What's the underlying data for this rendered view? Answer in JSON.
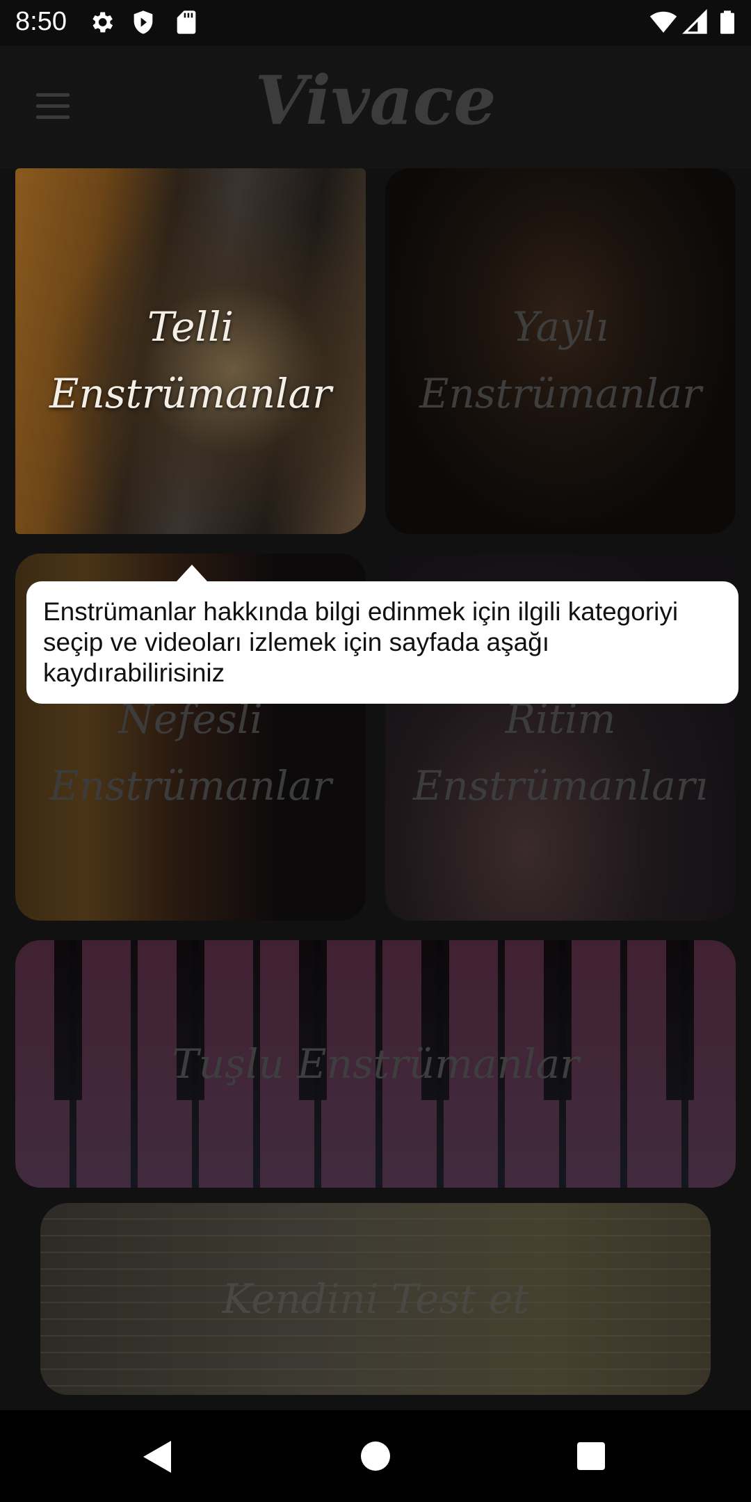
{
  "status_bar": {
    "time": "8:50",
    "left_icons": [
      "settings-icon",
      "shield-icon",
      "sd-card-icon"
    ],
    "right_icons": [
      "wifi-icon",
      "signal-icon",
      "battery-icon"
    ]
  },
  "app_bar": {
    "title": "Vivace",
    "menu_icon": "hamburger-menu-icon"
  },
  "categories": {
    "telli": {
      "line1": "Telli",
      "line2": "Enstrümanlar"
    },
    "yayli": {
      "line1": "Yaylı",
      "line2": "Enstrümanlar"
    },
    "nefesli": {
      "line1": "Nefesli",
      "line2": "Enstrümanlar"
    },
    "ritim": {
      "line1": "Ritim",
      "line2": "Enstrümanları"
    },
    "tuslu": {
      "label": "Tuşlu  Enstrümanlar"
    },
    "test": {
      "label": "Kendini Test et"
    }
  },
  "tooltip": {
    "text": "Enstrümanlar hakkında bilgi edinmek için ilgili kategoriyi seçip ve videoları izlemek için sayfada aşağı kaydırabilirisiniz"
  },
  "nav_bar": {
    "icons": [
      "back-icon",
      "home-icon",
      "recents-icon"
    ]
  }
}
